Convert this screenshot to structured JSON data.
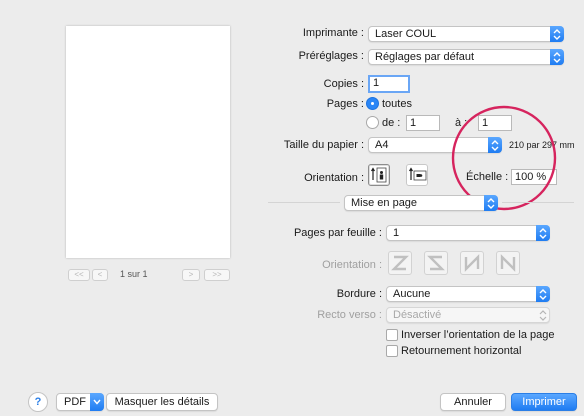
{
  "printer": {
    "label": "Imprimante :",
    "value": "Laser COUL"
  },
  "presets": {
    "label": "Préréglages :",
    "value": "Réglages par défaut"
  },
  "copies": {
    "label": "Copies :",
    "value": "1"
  },
  "pages": {
    "label": "Pages :",
    "all_label": "toutes",
    "from_label": "de :",
    "from_value": "1",
    "to_label": "à :",
    "to_value": "1"
  },
  "paper": {
    "label": "Taille du papier :",
    "value": "A4",
    "dims": "210 par 297 mm"
  },
  "orientation": {
    "label": "Orientation :"
  },
  "scale": {
    "label": "Échelle :",
    "value": "100 %"
  },
  "section": {
    "value": "Mise en page"
  },
  "pages_per_sheet": {
    "label": "Pages par feuille :",
    "value": "1"
  },
  "layout_direction": {
    "label": "Orientation :"
  },
  "border": {
    "label": "Bordure :",
    "value": "Aucune"
  },
  "duplex": {
    "label": "Recto verso :",
    "value": "Désactivé"
  },
  "reverse": {
    "label": "Inverser l’orientation de la page"
  },
  "flip": {
    "label": "Retournement horizontal"
  },
  "preview": {
    "page_indicator": "1 sur 1",
    "first": "<<",
    "prev": "<",
    "next": ">",
    "last": ">>"
  },
  "footer": {
    "help": "?",
    "pdf": "PDF",
    "hide_details": "Masquer les détails",
    "cancel": "Annuler",
    "print": "Imprimer"
  },
  "colors": {
    "accent": "#1f7cf2",
    "highlight_circle": "#d6245e"
  }
}
